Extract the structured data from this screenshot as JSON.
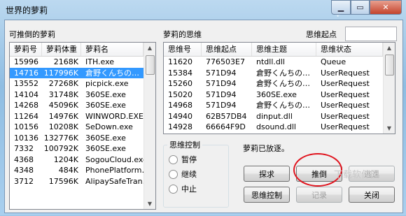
{
  "window": {
    "title": "世界的萝莉",
    "min_symbol": "▁",
    "max_symbol": "▭",
    "close_symbol": "✕"
  },
  "left_panel": {
    "label": "可推倒的萝莉",
    "columns": [
      "萝莉号",
      "萝莉体重",
      "萝莉名"
    ],
    "rows": [
      [
        "15996",
        "2168K",
        "ITH.exe"
      ],
      [
        "14716",
        "117996K",
        "倉野くんちの…"
      ],
      [
        "13552",
        "27268K",
        "picpick.exe"
      ],
      [
        "14104",
        "31748K",
        "360SE.exe"
      ],
      [
        "14268",
        "45096K",
        "360SE.exe"
      ],
      [
        "11264",
        "14976K",
        "WINWORD.EXE"
      ],
      [
        "10156",
        "10208K",
        "SeDown.exe"
      ],
      [
        "10136",
        "132776K",
        "360SE.exe"
      ],
      [
        "7332",
        "100792K",
        "360SE.exe"
      ],
      [
        "4368",
        "1204K",
        "SogouCloud.exe"
      ],
      [
        "4348",
        "484K",
        "PhonePlatform…"
      ],
      [
        "3712",
        "17596K",
        "AlipaySafeTran…"
      ]
    ],
    "selected_index": 1
  },
  "right_panel": {
    "label": "萝莉的思维",
    "search_label": "思维起点",
    "search_value": "",
    "columns": [
      "思维号",
      "思维起点",
      "思维主题",
      "思维状态"
    ],
    "rows": [
      [
        "11620",
        "776503E7",
        "ntdll.dll",
        "Queue"
      ],
      [
        "15384",
        "571D94",
        "倉野くんちの…",
        "UserRequest"
      ],
      [
        "15260",
        "571D94",
        "倉野くんちの…",
        "UserRequest"
      ],
      [
        "15020",
        "571D94",
        "360SE.exe",
        "UserRequest"
      ],
      [
        "14968",
        "571D94",
        "倉野くんちの…",
        "UserRequest"
      ],
      [
        "14940",
        "62B57DB4",
        "dinput.dll",
        "UserRequest"
      ],
      [
        "14928",
        "66664F9D",
        "dsound.dll",
        "UserRequest"
      ]
    ]
  },
  "control": {
    "label": "思维控制",
    "options": [
      "暂停",
      "继续",
      "中止"
    ]
  },
  "status_text": "萝莉已放逐。",
  "buttons": {
    "explore": "探求",
    "push": "推倒",
    "escape": "逃逸",
    "thought_control": "思维控制",
    "record": "记录",
    "close": "关闭"
  },
  "watermark": "下载软件园",
  "colors": {
    "selection": "#3399ff",
    "annotation_circle": "#e0141e"
  }
}
